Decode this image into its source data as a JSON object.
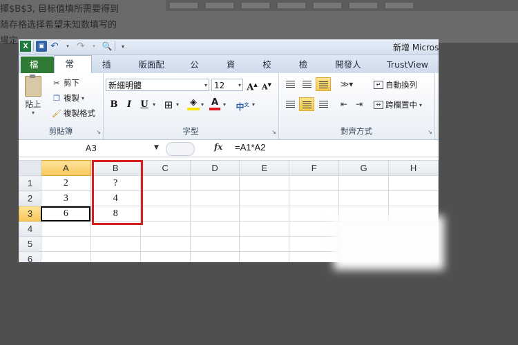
{
  "background": {
    "lines": [
      "擇$B$3, 目标值填所需要得到",
      "随存格选择希望未知数填写的",
      "場定"
    ]
  },
  "window": {
    "title": "新增 Micros",
    "qat_icons": [
      "excel-icon",
      "save-icon",
      "undo-icon",
      "redo-icon",
      "print-preview-icon"
    ]
  },
  "tabs": [
    "檔案",
    "常用",
    "插入",
    "版面配置",
    "公式",
    "資料",
    "校閱",
    "檢視",
    "開發人員",
    "TrustView"
  ],
  "active_tab": "常用",
  "ribbon": {
    "clipboard": {
      "paste": "貼上",
      "cut": "剪下",
      "copy": "複製",
      "format_painter": "複製格式",
      "label": "剪貼簿"
    },
    "font": {
      "name": "新細明體",
      "size": "12",
      "label": "字型"
    },
    "alignment": {
      "wrap_text": "自動換列",
      "merge_center": "跨欄置中",
      "label": "對齊方式"
    }
  },
  "formula_bar": {
    "name_box": "A3",
    "fx": "fx",
    "formula": "=A1*A2"
  },
  "sheet": {
    "columns": [
      "A",
      "B",
      "C",
      "D",
      "E",
      "F",
      "G",
      "H"
    ],
    "rows": [
      {
        "num": "1",
        "cells": [
          "2",
          "?",
          "",
          "",
          "",
          "",
          "",
          ""
        ]
      },
      {
        "num": "2",
        "cells": [
          "3",
          "4",
          "",
          "",
          "",
          "",
          "",
          ""
        ]
      },
      {
        "num": "3",
        "cells": [
          "6",
          "8",
          "",
          "",
          "",
          "",
          "",
          ""
        ]
      },
      {
        "num": "4",
        "cells": [
          "",
          "",
          "",
          "",
          "",
          "",
          "",
          ""
        ]
      },
      {
        "num": "5",
        "cells": [
          "",
          "",
          "",
          "",
          "",
          "",
          "",
          ""
        ]
      },
      {
        "num": "6",
        "cells": [
          "",
          "",
          "",
          "",
          "",
          "",
          "",
          ""
        ]
      }
    ],
    "active_cell": "A3",
    "selected_col": "A",
    "selected_row": "3"
  },
  "colors": {
    "file_tab": "#2f7a34",
    "highlight": "#d62020",
    "selection": "#f7c75c"
  }
}
